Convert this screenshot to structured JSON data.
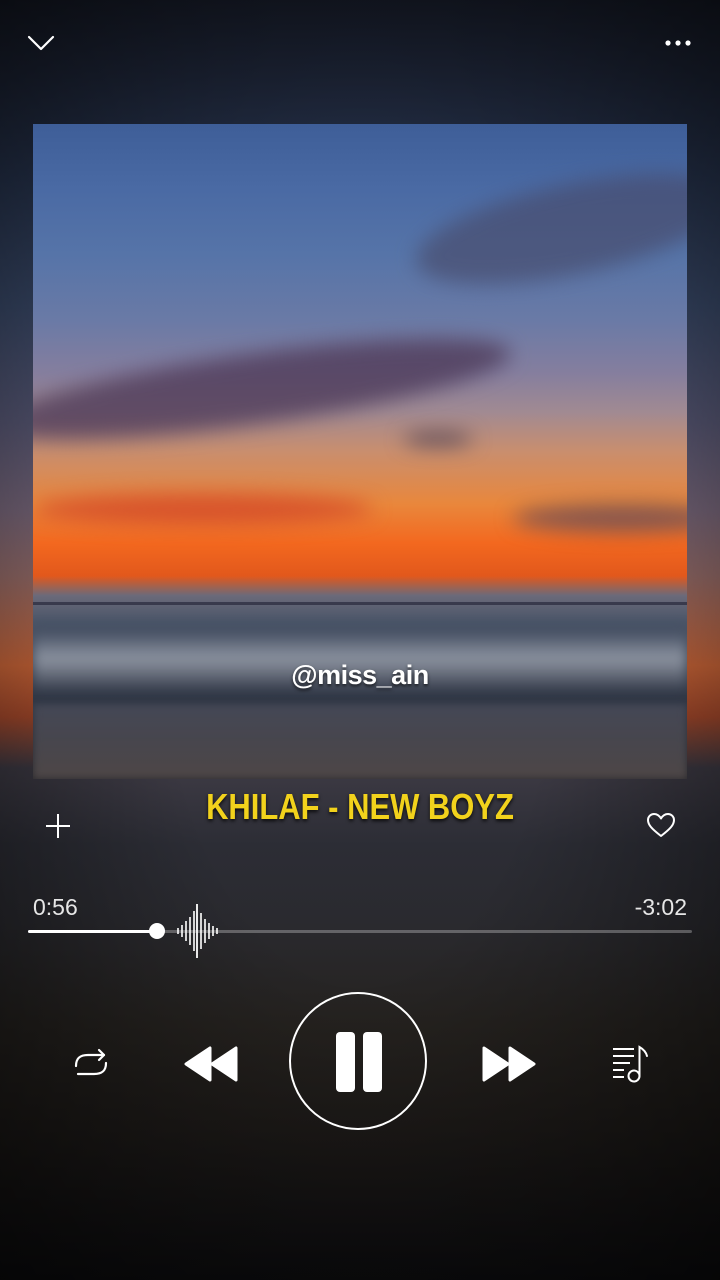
{
  "header": {
    "collapse_icon": "chevron-down-icon",
    "more_icon": "more-horizontal-icon"
  },
  "artwork": {
    "watermark": "@miss_ain"
  },
  "track": {
    "title": "KHILAF - NEW BOYZ",
    "title_color": "#f2d21c"
  },
  "actions": {
    "add_icon": "plus-icon",
    "like_icon": "heart-outline-icon"
  },
  "progress": {
    "elapsed": "0:56",
    "remaining": "-3:02",
    "fraction": 0.194
  },
  "controls": {
    "repeat_icon": "repeat-icon",
    "previous_icon": "rewind-icon",
    "play_pause_icon": "pause-icon",
    "next_icon": "fast-forward-icon",
    "queue_icon": "playlist-icon"
  }
}
